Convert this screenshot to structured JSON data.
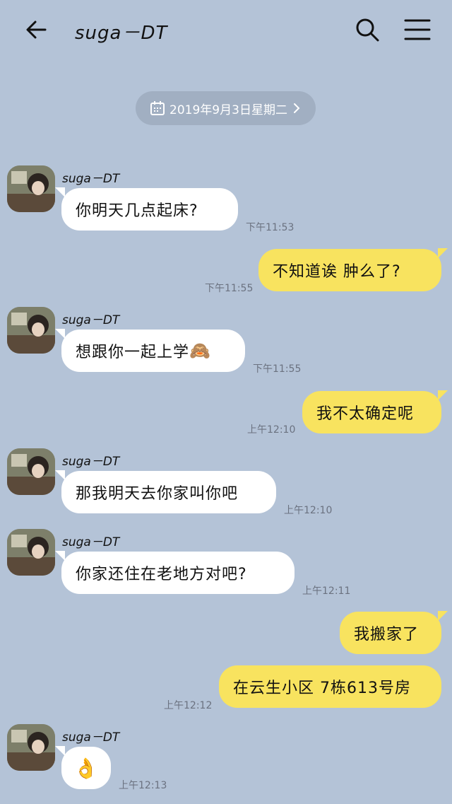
{
  "header": {
    "title": "suga－DT"
  },
  "date_pill": {
    "text": "2019年9月3日星期二"
  },
  "messages": [
    {
      "sender": "suga－DT",
      "text": "你明天几点起床?",
      "time": "下午11:53"
    },
    {
      "text": "不知道诶 肿么了?",
      "time": "下午11:55"
    },
    {
      "sender": "suga－DT",
      "text": "想跟你一起上学",
      "emoji": "🙈",
      "time": "下午11:55"
    },
    {
      "text": "我不太确定呢",
      "time": "上午12:10"
    },
    {
      "sender": "suga－DT",
      "text": "那我明天去你家叫你吧",
      "time": "上午12:10"
    },
    {
      "sender": "suga－DT",
      "text": "你家还住在老地方对吧?",
      "time": "上午12:11"
    },
    {
      "text": "我搬家了"
    },
    {
      "text": "在云生小区 7栋613号房",
      "time": "上午12:12"
    },
    {
      "sender": "suga－DT",
      "emoji": "👌",
      "time": "上午12:13"
    }
  ],
  "colors": {
    "background": "#b4c3d7",
    "incoming_bubble": "#ffffff",
    "outgoing_bubble": "#f8e35f"
  },
  "icons": [
    "back-arrow-icon",
    "search-icon",
    "menu-icon",
    "calendar-icon",
    "chevron-right-icon"
  ]
}
